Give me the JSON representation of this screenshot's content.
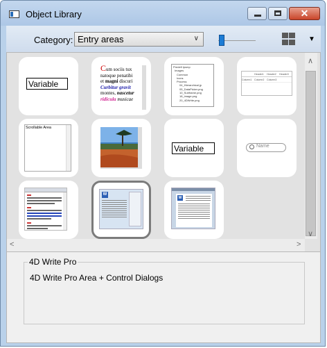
{
  "window": {
    "title": "Object Library",
    "close_glyph": "✕"
  },
  "toolbar": {
    "category_label": "Category:",
    "category_value": "Entry areas",
    "zoom_level": 0.1,
    "view_menu_glyph": "▼"
  },
  "tiles": [
    {
      "field_text": "Variable"
    },
    {
      "line1_cap": "C",
      "line1": "um sociis tux",
      "line2": "natoque penatibi",
      "line3_pre": "et ",
      "line3_bold": "magni",
      "line3_post": " discuri",
      "line4": "Curbitur gravit",
      "line5_pre": "montes, ",
      "line5_bold": "nascetur",
      "line6_pink": "ridicula",
      "line6_post": " musicae"
    },
    {
      "tree": [
        "Predefi Ipsmp",
        "Images",
        "Common",
        "Icons",
        "Process",
        "04_Hierarchical.jp",
        "05_DataPicker.png",
        "10_Subframe.png",
        "18_image.png",
        "20_4DWrite.png"
      ]
    },
    {
      "headers": [
        "Header1",
        "Header2",
        "Header3"
      ],
      "cells": [
        "Column1",
        "Column2",
        "Column3"
      ]
    },
    {
      "label": "Scrollable Area"
    },
    {},
    {
      "field_text": "Variable"
    },
    {
      "search_placeholder": "Name"
    },
    {},
    {},
    {}
  ],
  "details": {
    "group_title": "4D Write Pro",
    "description": "4D Write Pro Area + Control Dialogs"
  },
  "colors": {
    "accent": "#1c7cd5",
    "close_button": "#c9452a",
    "selected_border": "#7b7b7b"
  }
}
